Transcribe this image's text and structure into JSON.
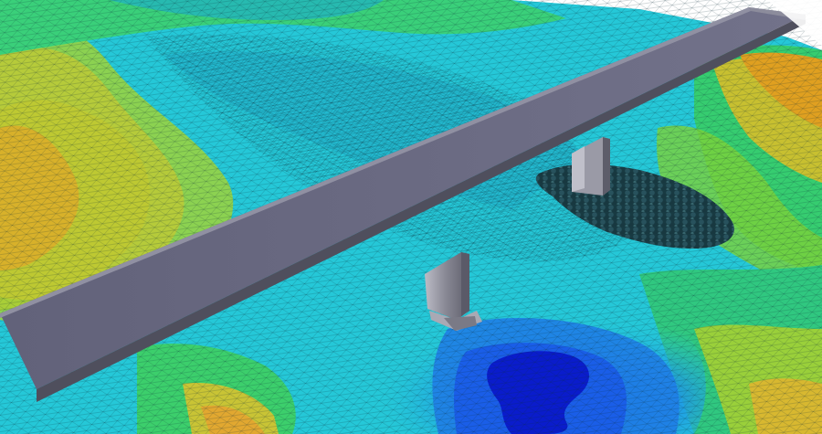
{
  "scene": {
    "subject": "bridge-over-riverbed-mesh",
    "colors": {
      "background": "#ffffff",
      "deck_top": "#686878",
      "deck_side": "#4f4f5d",
      "deck_edge": "#8c8c9c",
      "pier": "#8a8a96",
      "pier_dark": "#5d5d6a",
      "pier_light": "#b9b9c3",
      "riprap": "#1f3f47",
      "terrain_high": "#e0b030",
      "terrain_mid_high": "#8fd23a",
      "terrain_mid": "#2fd08a",
      "terrain_low": "#25c8d8",
      "terrain_deep": "#1860e0",
      "terrain_deepest": "#0a18c8",
      "mesh_line": "#0b2a35"
    },
    "icons": [
      "bridge-deck",
      "bridge-pier",
      "scour-hole",
      "riprap-apron",
      "mesh-grid"
    ]
  }
}
